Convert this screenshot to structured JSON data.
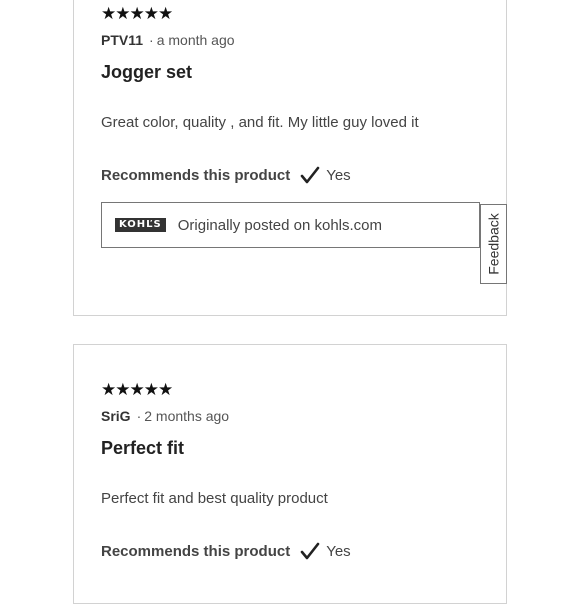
{
  "reviews": [
    {
      "rating": 5,
      "stars_text": "★★★★★",
      "author": "PTV11",
      "time": "a month ago",
      "title": "Jogger set",
      "body": "Great color, quality , and fit. My little guy loved it",
      "recommend_label": "Recommends this product",
      "recommend_value": "Yes",
      "source_logo": "KOHĽS",
      "source_text": "Originally posted on kohls.com"
    },
    {
      "rating": 5,
      "stars_text": "★★★★★",
      "author": "SriG",
      "time": "2 months ago",
      "title": "Perfect fit",
      "body": "Perfect fit and best quality product",
      "recommend_label": "Recommends this product",
      "recommend_value": "Yes"
    }
  ],
  "feedback": {
    "label": "Feedback"
  },
  "icons": {
    "check": "checkmark-icon",
    "star": "star-icon"
  },
  "colors": {
    "border": "#d2d2d2",
    "text": "#333333",
    "logo_bg": "#333333"
  }
}
